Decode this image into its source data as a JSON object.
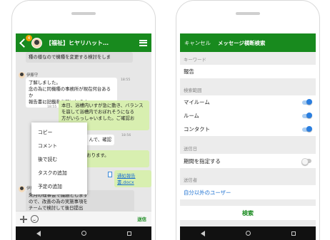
{
  "left_phone": {
    "header": {
      "badge_count": "4",
      "room_title": "【福祉】ヒヤリハット…"
    },
    "messages": [
      {
        "text": "種の様なので機種を変更する検討をしま",
        "time": ""
      },
      {
        "sender": "伊藤守",
        "text": "了解しました。\n念の為に同機種の事務所が現在何台あるか\n報告書に記載をお願いします。",
        "time": "18:55"
      },
      {
        "text": "本日、浴槽内いすが急に動き、バランス\nを崩して浴槽内でおぼれそうになる\n方がいらっしゃいました。ご確認お\n願いします。",
        "time": "18:55",
        "read": "16/16 既読"
      },
      {
        "text": "んで、確認",
        "time": "18:56"
      },
      {
        "text": "ありがとうございます。参考にさせて頂き\n次ます。",
        "time": "18:56",
        "text_alt": "承知しております。\nします。"
      },
      {
        "attachment": "通処報告書.docx",
        "time": "18:56"
      },
      {
        "sender": "伊藤守",
        "text": "来月の理事会で議題とします\nので、改善の為の実施事項を\nチームで検討して後日提出\nをお願いします。",
        "time": "18:57"
      }
    ],
    "context_menu": [
      "コピー",
      "コメント",
      "後で読む",
      "タスクの追加",
      "予定の追加"
    ],
    "input_bar": {
      "send_label": "送信"
    }
  },
  "right_phone": {
    "header": {
      "cancel_label": "キャンセル",
      "title": "メッセージ横断検索"
    },
    "keyword_label": "キーワード",
    "keyword_value": "報告",
    "scope_label": "検索範囲",
    "scope_items": [
      {
        "label": "マイルーム",
        "on": true
      },
      {
        "label": "ルーム",
        "on": true
      },
      {
        "label": "コンタクト",
        "on": true
      }
    ],
    "date_label": "送信日",
    "date_item": {
      "label": "期間を指定する",
      "on": false
    },
    "sender_label": "送信者",
    "sender_value": "自分以外のユーザー",
    "search_button": "検索"
  },
  "colors": {
    "brand_green": "#188a1e",
    "toggle_blue": "#2a7ee0",
    "link_blue": "#1a6fd1",
    "out_bubble": "#d8efb0"
  }
}
